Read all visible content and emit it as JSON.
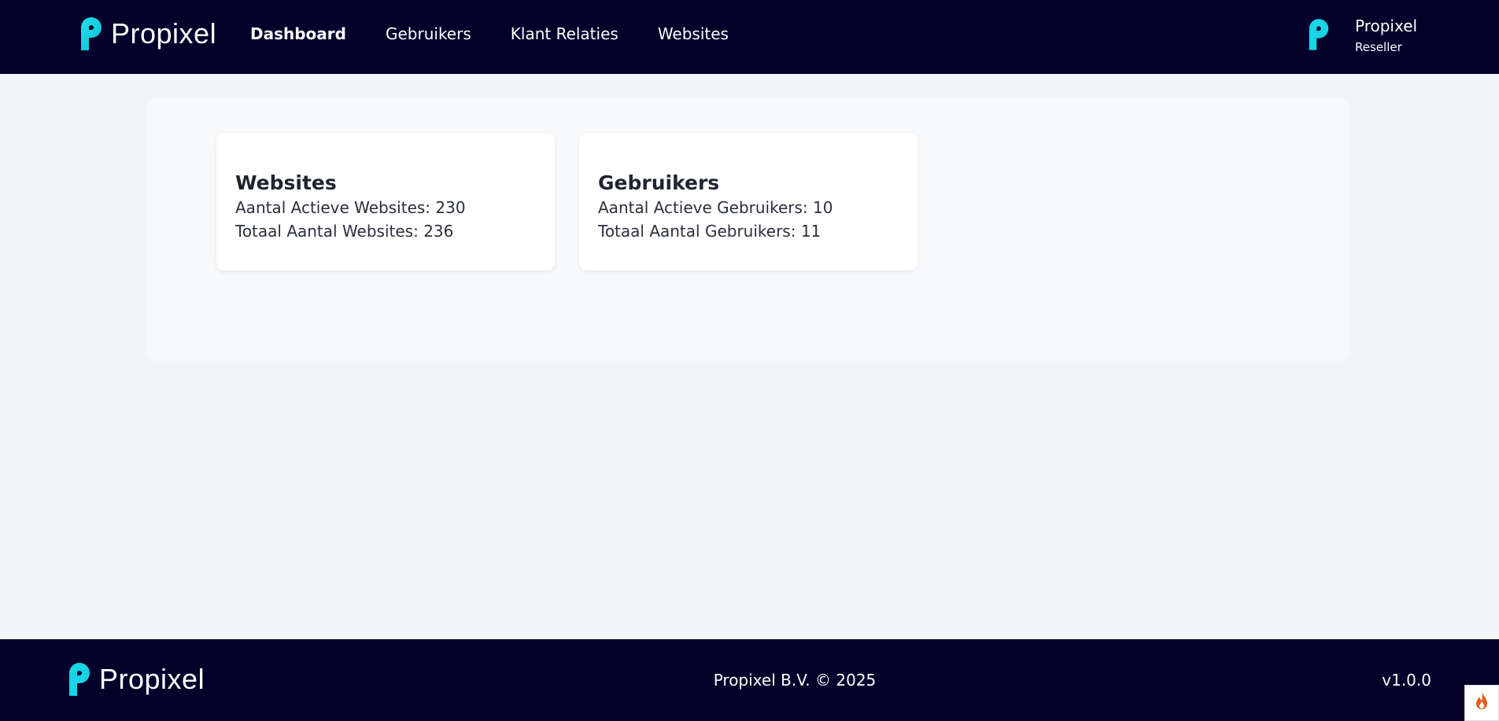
{
  "header": {
    "brand": "Propixel",
    "nav": [
      {
        "label": "Dashboard",
        "active": true
      },
      {
        "label": "Gebruikers",
        "active": false
      },
      {
        "label": "Klant Relaties",
        "active": false
      },
      {
        "label": "Websites",
        "active": false
      }
    ],
    "user": {
      "name": "Propixel",
      "role": "Reseller"
    }
  },
  "cards": [
    {
      "title": "Websites",
      "lines": [
        {
          "label": "Aantal Actieve Websites:",
          "value": "230"
        },
        {
          "label": "Totaal Aantal Websites:",
          "value": "236"
        }
      ]
    },
    {
      "title": "Gebruikers",
      "lines": [
        {
          "label": "Aantal Actieve Gebruikers:",
          "value": "10"
        },
        {
          "label": "Totaal Aantal Gebruikers:",
          "value": "11"
        }
      ]
    }
  ],
  "footer": {
    "brand": "Propixel",
    "copyright": "Propixel B.V. © 2025",
    "version": "v1.0.0"
  },
  "icons": {
    "logo": "propixel-p-icon",
    "corner": "flame-icon"
  },
  "colors": {
    "header_bg": "#03012a",
    "accent": "#19d3e6",
    "page_bg": "#f2f5f8"
  }
}
